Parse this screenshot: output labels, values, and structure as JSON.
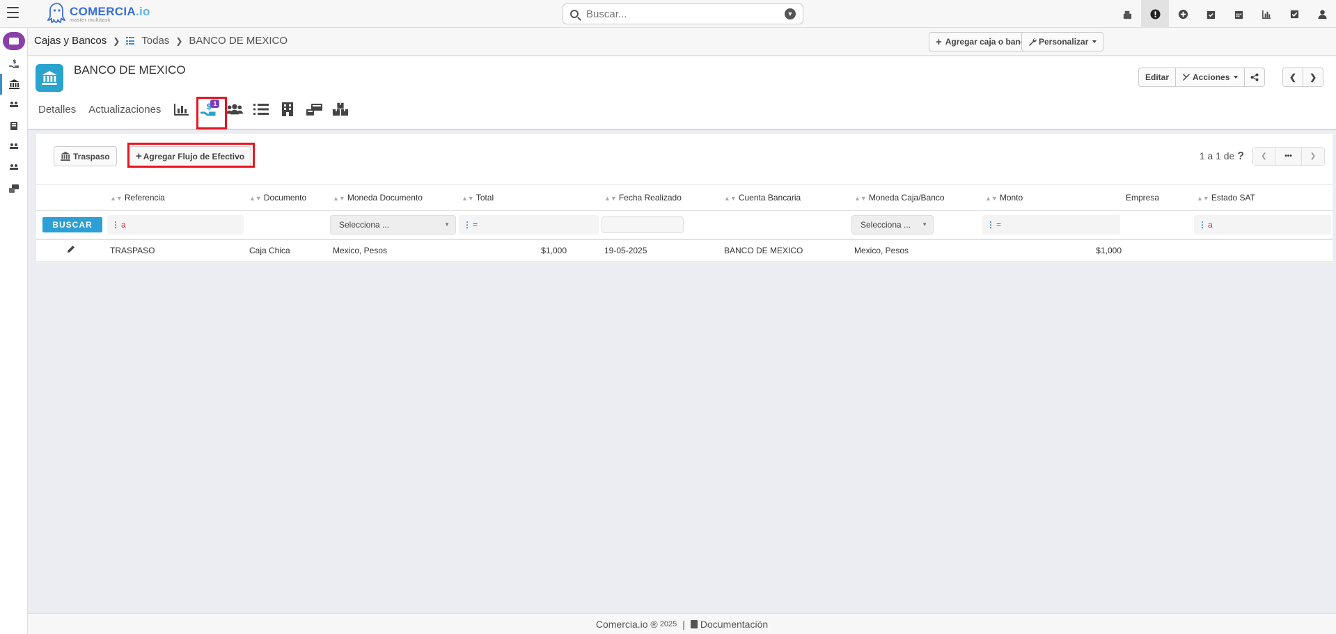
{
  "app": {
    "logo_main": "COMERCIA",
    "logo_io": ".io",
    "logo_sub": "master multitask"
  },
  "search": {
    "placeholder": "Buscar..."
  },
  "top_icons": [
    "cash-register-icon",
    "alert-icon",
    "plus-circle-icon",
    "calendar-check-icon",
    "calendar-icon",
    "chart-icon",
    "checkbox-icon",
    "user-icon"
  ],
  "breadcrumb": {
    "root": "Cajas y Bancos",
    "link": "Todas",
    "current": "BANCO DE MEXICO"
  },
  "top_actions": {
    "add_label": "Agregar caja o banco",
    "customize_label": "Personalizar"
  },
  "record": {
    "title": "BANCO DE MEXICO",
    "edit_label": "Editar",
    "actions_label": "Acciones"
  },
  "tabs": {
    "details": "Detalles",
    "updates": "Actualizaciones",
    "cashflow_badge": "1"
  },
  "toolbar": {
    "transfer_label": "Traspaso",
    "add_flow_label": "Agregar Flujo de Efectivo"
  },
  "pagination": {
    "text": "1 a 1  de",
    "help": "?",
    "more": "•••"
  },
  "table": {
    "columns": [
      "Referencia",
      "Documento",
      "Moneda Documento",
      "Total",
      "Fecha Realizado",
      "Cuenta Bancaria",
      "Moneda Caja/Banco",
      "Monto",
      "Empresa",
      "Estado SAT"
    ],
    "buscar_label": "BUSCAR",
    "filter_text_op": "a",
    "filter_eq_op": "=",
    "select_placeholder": "Selecciona ...",
    "rows": [
      {
        "referencia": "TRASPASO",
        "documento": "Caja Chica",
        "moneda_documento": "Mexico, Pesos",
        "total": "$1,000",
        "fecha": "19-05-2025",
        "cuenta": "BANCO DE MEXICO",
        "moneda_caja": "Mexico, Pesos",
        "monto": "$1,000",
        "empresa": "",
        "estado_sat": ""
      }
    ]
  },
  "footer": {
    "brand": "Comercia.io ®",
    "year": "2025",
    "sep": "|",
    "docs": "Documentación"
  },
  "colors": {
    "accent": "#2b9fd6",
    "brand_purple": "#8b3fa8",
    "bank_icon": "#2aa4cf",
    "highlight": "#e8141f",
    "badge": "#7a3fb8"
  }
}
